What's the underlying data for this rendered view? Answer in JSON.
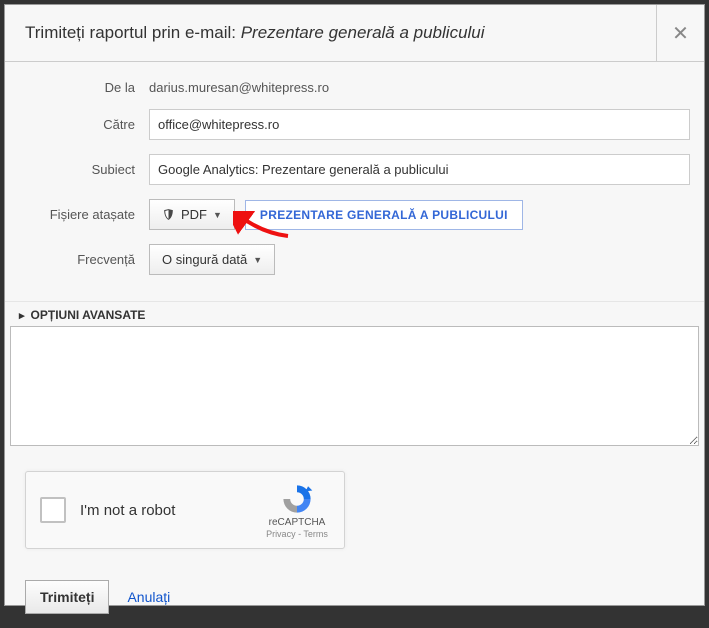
{
  "header": {
    "title_prefix": "Trimiteți raportul prin e-mail: ",
    "title_italic": "Prezentare generală a publicului"
  },
  "form": {
    "from_label": "De la",
    "from_value": "darius.muresan@whitepress.ro",
    "to_label": "Către",
    "to_value": "office@whitepress.ro",
    "subject_label": "Subiect",
    "subject_value": "Google Analytics: Prezentare generală a publicului",
    "attach_label": "Fișiere atașate",
    "pdf_button": "PDF",
    "chip_label": "PREZENTARE GENERALĂ A PUBLICULUI",
    "freq_label": "Frecvență",
    "freq_value": "O singură dată",
    "advanced_label": "OPȚIUNI AVANSATE"
  },
  "captcha": {
    "label": "I'm not a robot",
    "brand": "reCAPTCHA",
    "privacy": "Privacy",
    "terms": "Terms"
  },
  "footer": {
    "submit": "Trimiteți",
    "cancel": "Anulați"
  }
}
